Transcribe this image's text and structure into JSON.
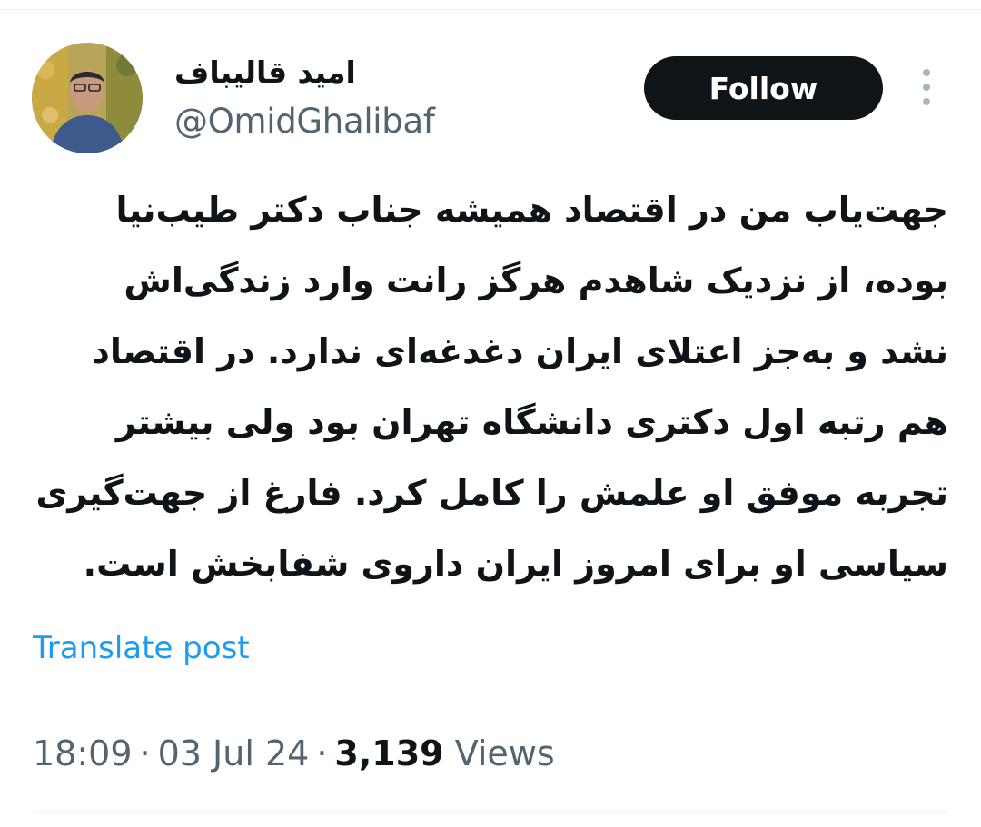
{
  "author": {
    "display_name": "امید قالیباف",
    "handle": "@OmidGhalibaf",
    "avatar_icon": "profile-photo"
  },
  "actions": {
    "follow_label": "Follow",
    "more_icon": "vertical-ellipsis-icon"
  },
  "tweet": {
    "lines": [
      "جهت‌یاب من در اقتصاد همیشه جناب دکتر طیب‌نیا",
      "بوده، از نزدیک شاهدم هرگز رانت وارد زندگی‌اش",
      "نشد و به‌جز اعتلای ایران دغدغه‌ای ندارد. در اقتصاد",
      "هم رتبه اول دکتری دانشگاه تهران بود ولی بیشتر",
      "تجربه موفق او علمش را کامل کرد. فارغ از جهت‌گیری",
      "سیاسی او برای امروز ایران داروی شفابخش است."
    ],
    "translate_label": "Translate post"
  },
  "meta": {
    "time": "18:09",
    "separator": "·",
    "date": "03 Jul 24",
    "views_count": "3,139",
    "views_label": "Views"
  },
  "colors": {
    "text": "#0f1419",
    "secondary": "#536471",
    "link": "#1d9bf0",
    "button_bg": "#0f1419"
  }
}
